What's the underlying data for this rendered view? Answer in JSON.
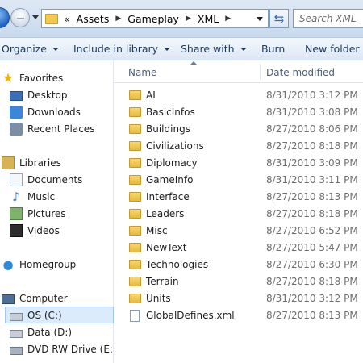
{
  "address": {
    "crumbs": [
      "Assets",
      "Gameplay",
      "XML"
    ],
    "overflow": "«",
    "search_placeholder": "Search XML"
  },
  "toolbar": {
    "organize": "Organize",
    "include": "Include in library",
    "share": "Share with",
    "burn": "Burn",
    "new_folder": "New folder"
  },
  "nav": {
    "favorites": "Favorites",
    "desktop": "Desktop",
    "downloads": "Downloads",
    "recent": "Recent Places",
    "libraries": "Libraries",
    "documents": "Documents",
    "music": "Music",
    "pictures": "Pictures",
    "videos": "Videos",
    "homegroup": "Homegroup",
    "computer": "Computer",
    "os": "OS (C:)",
    "data": "Data (D:)",
    "dvd": "DVD RW Drive (E:) Si"
  },
  "columns": {
    "name": "Name",
    "date": "Date modified"
  },
  "files": [
    {
      "name": "AI",
      "date": "8/31/2010 3:12 PM",
      "type": "folder"
    },
    {
      "name": "BasicInfos",
      "date": "8/31/2010 3:08 PM",
      "type": "folder"
    },
    {
      "name": "Buildings",
      "date": "8/27/2010 8:06 PM",
      "type": "folder"
    },
    {
      "name": "Civilizations",
      "date": "8/27/2010 8:18 PM",
      "type": "folder"
    },
    {
      "name": "Diplomacy",
      "date": "8/31/2010 3:09 PM",
      "type": "folder"
    },
    {
      "name": "GameInfo",
      "date": "8/31/2010 3:11 PM",
      "type": "folder"
    },
    {
      "name": "Interface",
      "date": "8/27/2010 8:13 PM",
      "type": "folder"
    },
    {
      "name": "Leaders",
      "date": "8/27/2010 8:18 PM",
      "type": "folder"
    },
    {
      "name": "Misc",
      "date": "8/27/2010 6:52 PM",
      "type": "folder"
    },
    {
      "name": "NewText",
      "date": "8/27/2010 5:47 PM",
      "type": "folder"
    },
    {
      "name": "Technologies",
      "date": "8/27/2010 6:30 PM",
      "type": "folder"
    },
    {
      "name": "Terrain",
      "date": "8/27/2010 8:18 PM",
      "type": "folder"
    },
    {
      "name": "Units",
      "date": "8/31/2010 3:12 PM",
      "type": "folder"
    },
    {
      "name": "GlobalDefines.xml",
      "date": "8/27/2010 8:13 PM",
      "type": "file"
    }
  ]
}
